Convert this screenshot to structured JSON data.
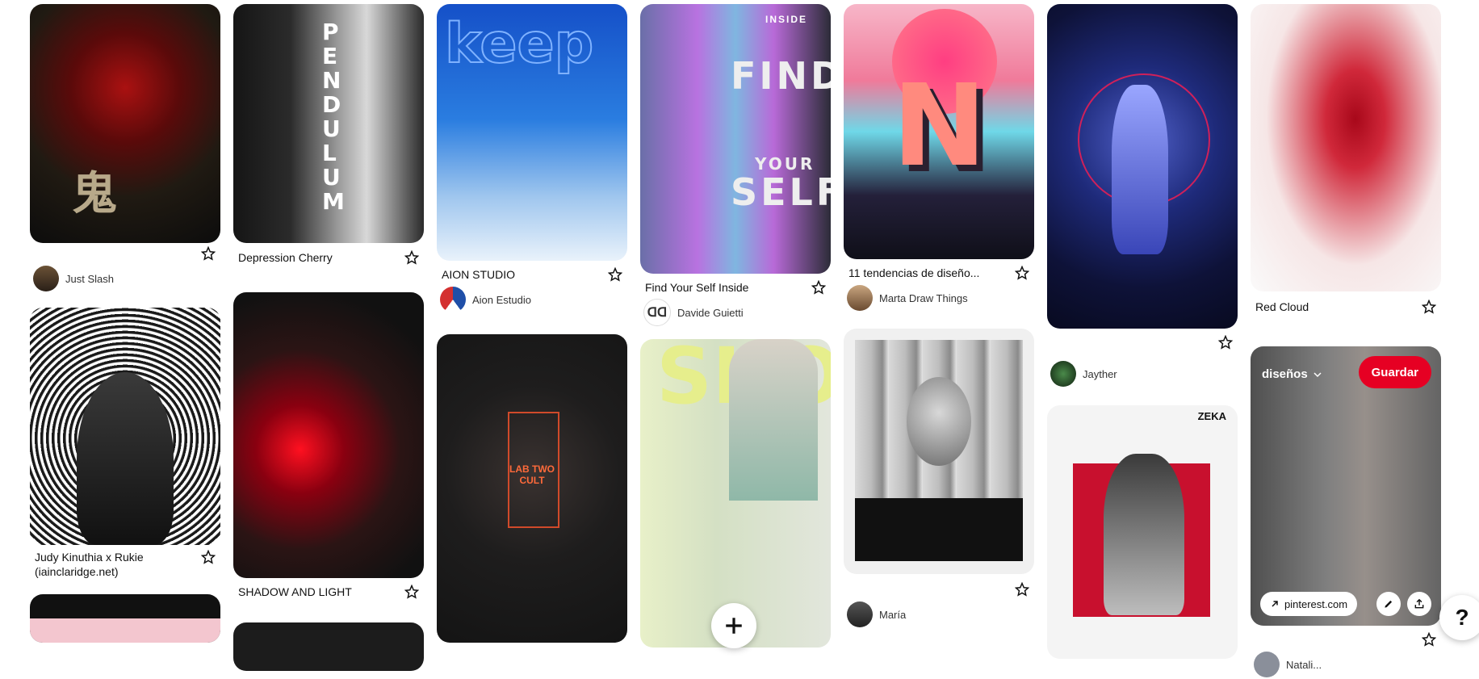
{
  "pins": {
    "p1": {
      "author": "Just Slash"
    },
    "p2": {
      "title": "Judy Kinuthia x Rukie (iainclaridge.net)"
    },
    "p3": {
      "title": "Depression Cherry"
    },
    "p4": {
      "title": "SHADOW AND LIGHT"
    },
    "p5": {
      "title": "AION STUDIO",
      "author": "Aion Estudio"
    },
    "p7": {
      "title": "Find Your Self Inside",
      "author": "Davide Guietti"
    },
    "p9": {
      "title": "11 tendencias de diseño...",
      "author": "Marta Draw Things"
    },
    "p10": {
      "author": "María"
    },
    "p11": {
      "author": "Jayther"
    },
    "p13": {
      "title": "Red Cloud"
    },
    "p14": {
      "board": "diseños",
      "save": "Guardar",
      "domain": "pinterest.com"
    },
    "p15": {
      "author": "Natali..."
    }
  },
  "poster_text": {
    "pendulum": "PENDULUM",
    "keep": "keep",
    "find": "FIND",
    "your": "YOUR",
    "self": "SELF",
    "inside": "INSIDE",
    "kanji": "鬼",
    "shop": "SHO",
    "zeka": "ZEKA",
    "lab": "LAB TWO CULT"
  },
  "help": {
    "label": "?"
  },
  "colors": {
    "save": "#e60023",
    "text": "#111111"
  }
}
